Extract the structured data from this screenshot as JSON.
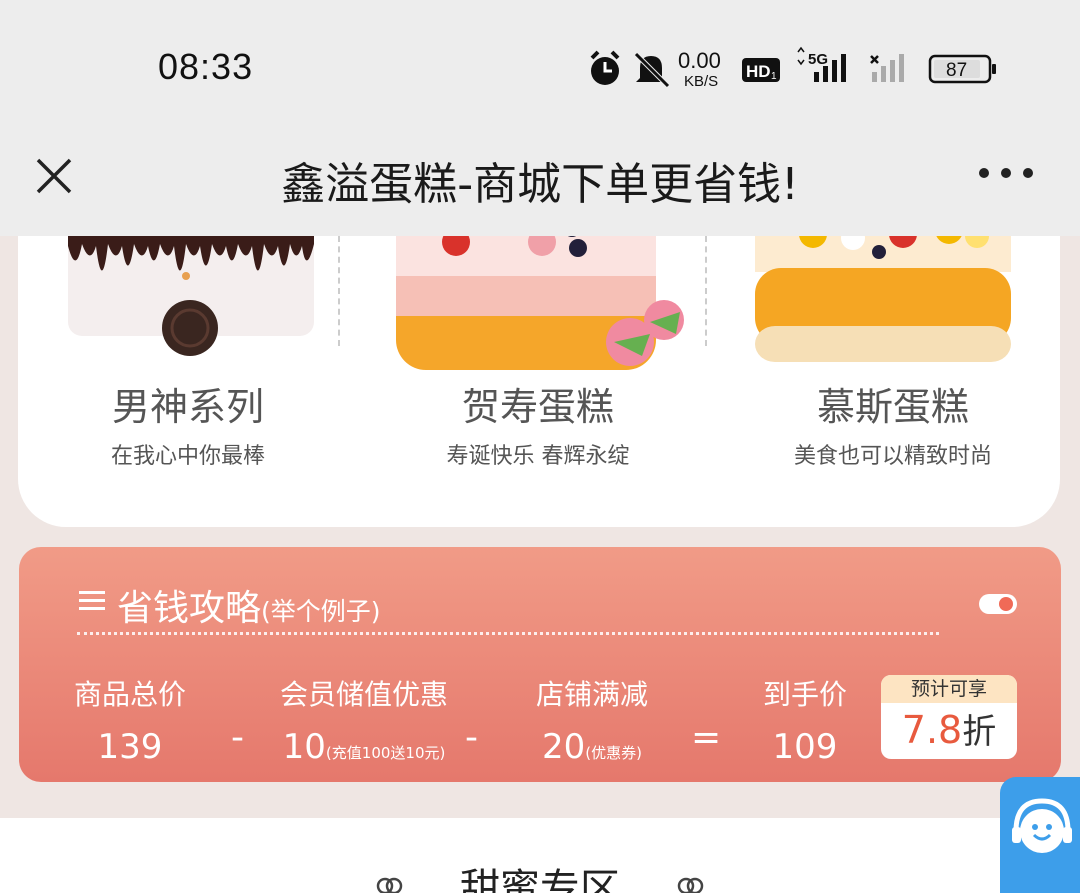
{
  "status_bar": {
    "time": "08:33",
    "net_speed_value": "0.00",
    "net_speed_unit": "KB/S",
    "hd_label": "HD",
    "hd_sub": "1",
    "signal_label": "5G",
    "battery": "87"
  },
  "nav": {
    "title": "鑫溢蛋糕-商城下单更省钱!"
  },
  "categories": [
    {
      "name": "男神系列",
      "desc": "在我心中你最棒"
    },
    {
      "name": "贺寿蛋糕",
      "desc": "寿诞快乐 春辉永绽"
    },
    {
      "name": "慕斯蛋糕",
      "desc": "美食也可以精致时尚"
    }
  ],
  "savings": {
    "title": "省钱攻略",
    "subtitle": "(举个例子)",
    "items": [
      {
        "label": "商品总价",
        "value": "139",
        "note": ""
      },
      {
        "label": "会员储值优惠",
        "value": "10",
        "note": "(充值100送10元)"
      },
      {
        "label": "店铺满减",
        "value": "20",
        "note": "(优惠券)"
      },
      {
        "label": "到手价",
        "value": "109",
        "note": ""
      }
    ],
    "op_minus": "-",
    "op_equals": "=",
    "badge_label": "预计可享",
    "badge_value": "7.8",
    "badge_unit": "折"
  },
  "sweet_zone": {
    "title": "甜蜜专区"
  },
  "colors": {
    "accent": "#e5786c",
    "discount": "#e85a3e",
    "service": "#3d9eea"
  }
}
